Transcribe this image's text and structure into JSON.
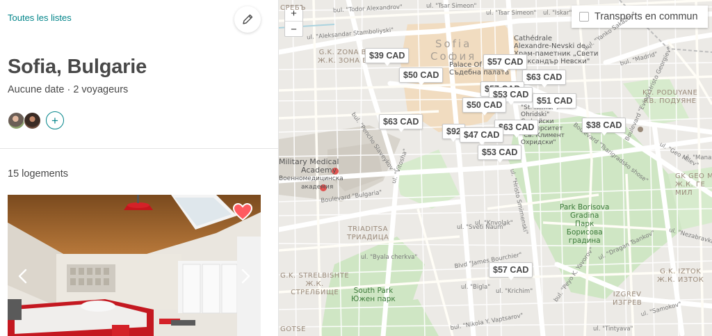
{
  "header": {
    "all_lists": "Toutes les listes",
    "title": "Sofia, Bulgarie",
    "subtitle": "Aucune date · 2 voyageurs",
    "add_symbol": "+"
  },
  "listing": {
    "count": "15 logements"
  },
  "map": {
    "zoom_in": "+",
    "zoom_out": "−",
    "transit_label": "Transports en commun",
    "city_latin": "Sofia",
    "city_cyrillic": "София",
    "price_pins": [
      "$39 CAD",
      "$50 CAD",
      "$57 CAD",
      "$63 CAD",
      "$57 CAD",
      "$53 CAD",
      "$50 CAD",
      "$51 CAD",
      "$63 CAD",
      "$63 CAD",
      "$92",
      "$47 CAD",
      "$53 CAD",
      "$38 CAD",
      "$57 CAD"
    ],
    "places": {
      "cathedral": [
        "Cathédrale",
        "Alexandre-Nevski de...",
        "Храм-паметник „Свети",
        "Александър Невски\""
      ],
      "palace": [
        "Palace Of",
        "Съдебна палата"
      ],
      "university": [
        "Sofia",
        "Universitiy",
        "\"St. Kliment",
        "Ohridski\"",
        "Софийски",
        "университет",
        "\"Св. Климент",
        "Охридски\""
      ],
      "academy": [
        "Military Medical",
        "Academy",
        "Военномедицинска",
        "академия"
      ],
      "borisova": [
        "Park Borisova",
        "Gradina",
        "Парк",
        "Борисова",
        "градина"
      ],
      "south_park": [
        "South Park",
        "Южен парк"
      ]
    },
    "districts": {
      "zona_b": [
        "G.K. ZONA B",
        "Ж.К. ЗОНА Б"
      ],
      "poduyane": [
        "KV. PODUYANE",
        "КВ. ПОДУЯНЕ"
      ],
      "triaditsa": [
        "TRIADITSA",
        "ТРИАДИЦА"
      ],
      "strelbishte": [
        "G.K. STRELBISHTE",
        "Ж.К.",
        "СТРЕЛБИЩЕ"
      ],
      "iztok": [
        "G.K. IZTOK",
        "Ж.К. ИЗТОК"
      ],
      "izgrev": [
        "IZGREV",
        "ИЗГРЕВ"
      ],
      "geo_mi": [
        "GK GEO M",
        "Ж.К. ГЕ",
        "МИЛ"
      ],
      "srebro": [
        "СРЕБЪ"
      ],
      "gotse": [
        "GOTSE"
      ]
    },
    "streets": [
      "bul. \"Todor Alexandrov\"",
      "ul. \"Tsar Simeon\"",
      "ul. \"Tsar Simeon\"",
      "ul. \"Iskar\"",
      "ul. \"Aleksandar Stamboliyski\"",
      "bul. \"Madrid\"",
      "bul. \"Yanko Sakazov\"",
      "Boulevard \"Evlogi Hristo Georgiev\"",
      "bul. \"Pencho Slaveykov\"",
      "ul. \"Vitosha\"",
      "Boulevard \"Bulgaria\"",
      "ul. \"Knvolak\"",
      "ul. \"Sveti Naum\"",
      "ul. \"Byala cherkva\"",
      "Blvd \"James Bourchier\"",
      "ul. \"Bigla\"",
      "ul. \"Krichim\"",
      "bul. \"Nikola Y. Vaptsarov\"",
      "ul. \"Hristo Smirnenski\"",
      "Boulevard \"Tsarigradsko shose\"",
      "ul. \"Geo Milev\"",
      "ul. \"Manastir\"",
      "ul. \"Dragan Tsankov\"",
      "ul. \"Samokov\"",
      "ul. \"Tintyava\"",
      "bul. \"Peyo K. Yavorov\"",
      "ul. \"Nezabravka\""
    ]
  },
  "colors": {
    "teal": "#008489",
    "heart": "#ff5a5f",
    "park": "#cfe6c4",
    "center": "#f1dcc0",
    "water": "#aad3df"
  },
  "icons": {
    "edit": "pencil-icon",
    "heart": "heart-icon",
    "prev": "chevron-left-icon",
    "next": "chevron-right-icon",
    "hospital": "hospital-icon"
  }
}
